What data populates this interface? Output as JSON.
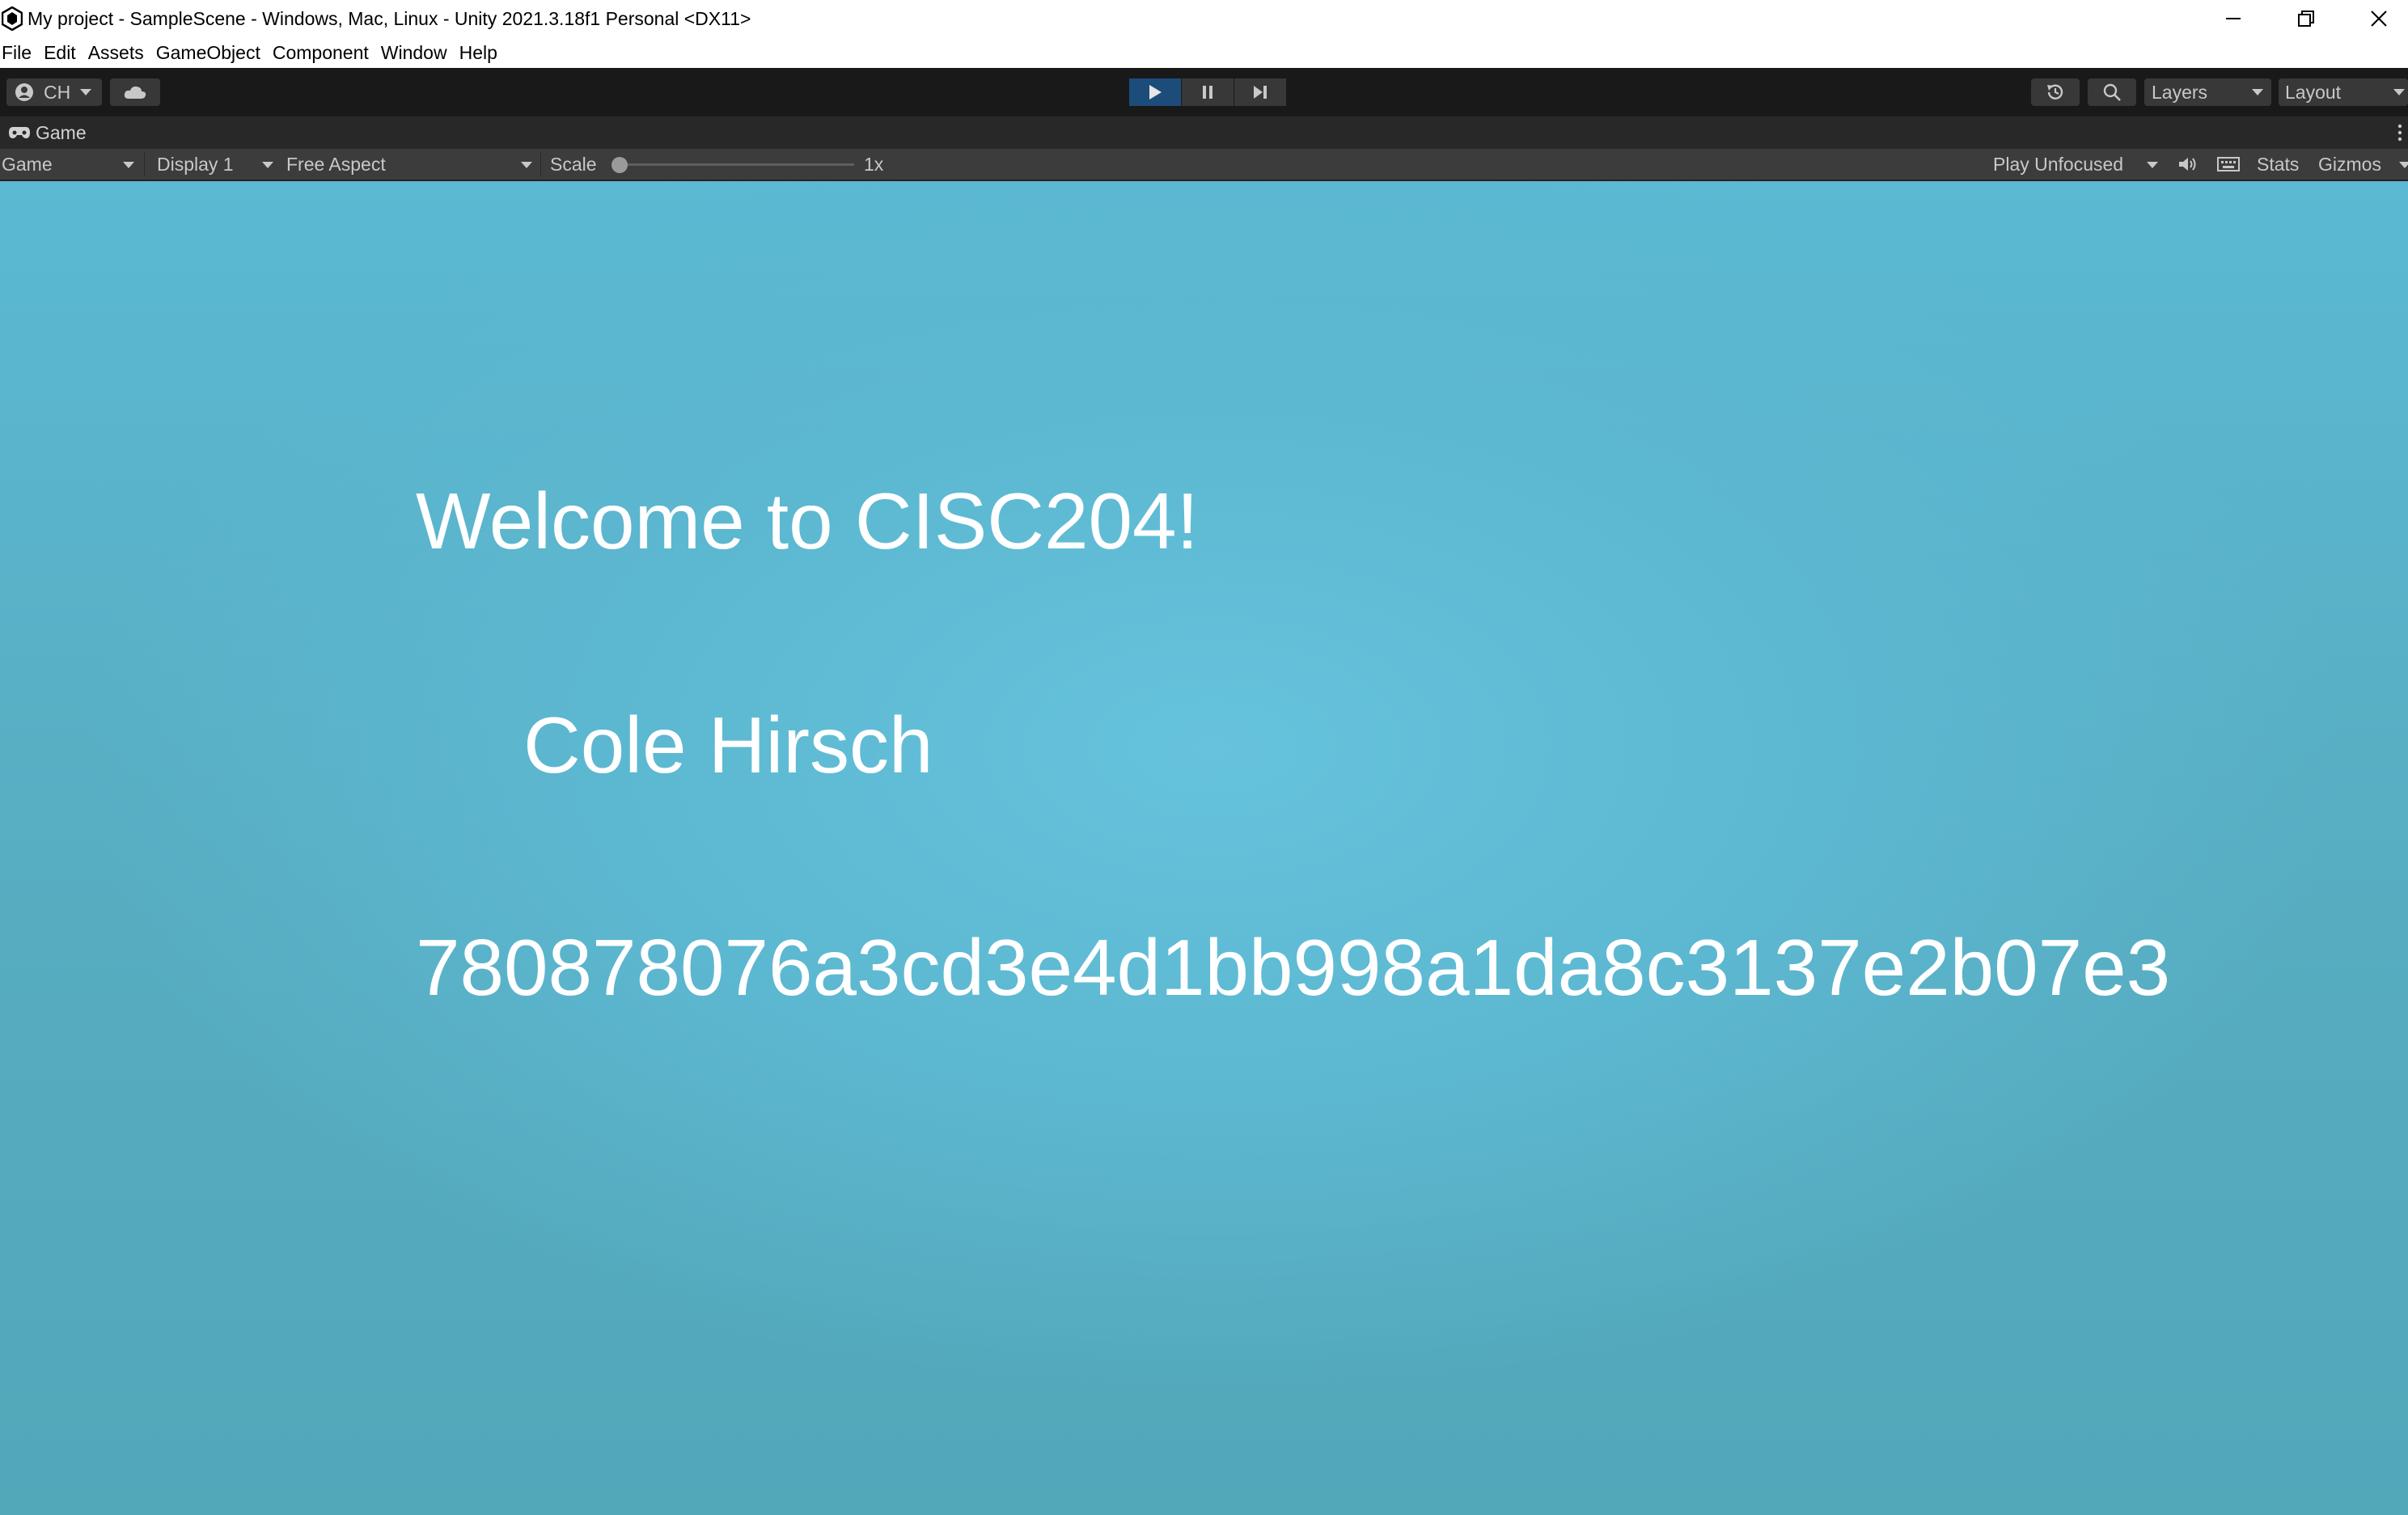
{
  "window": {
    "title": "My project - SampleScene - Windows, Mac, Linux - Unity 2021.3.18f1 Personal <DX11>"
  },
  "menu": [
    "File",
    "Edit",
    "Assets",
    "GameObject",
    "Component",
    "Window",
    "Help"
  ],
  "toolbar": {
    "account_label": "CH",
    "layers_label": "Layers",
    "layout_label": "Layout",
    "play_state": "playing"
  },
  "game_tab": {
    "label": "Game"
  },
  "game_toolbar": {
    "view_mode": "Game",
    "display": "Display 1",
    "aspect": "Free Aspect",
    "scale_label": "Scale",
    "scale_value": "1x",
    "play_mode": "Play Unfocused",
    "stats_label": "Stats",
    "gizmos_label": "Gizmos"
  },
  "scene": {
    "welcome": "Welcome to CISC204!",
    "name": "Cole Hirsch",
    "hash": "780878076a3cd3e4d1bb998a1da8c3137e2b07e3"
  },
  "colors": {
    "game_background": "#5bb9d3",
    "play_active": "#1c4d7a",
    "toolbar": "#191919"
  }
}
